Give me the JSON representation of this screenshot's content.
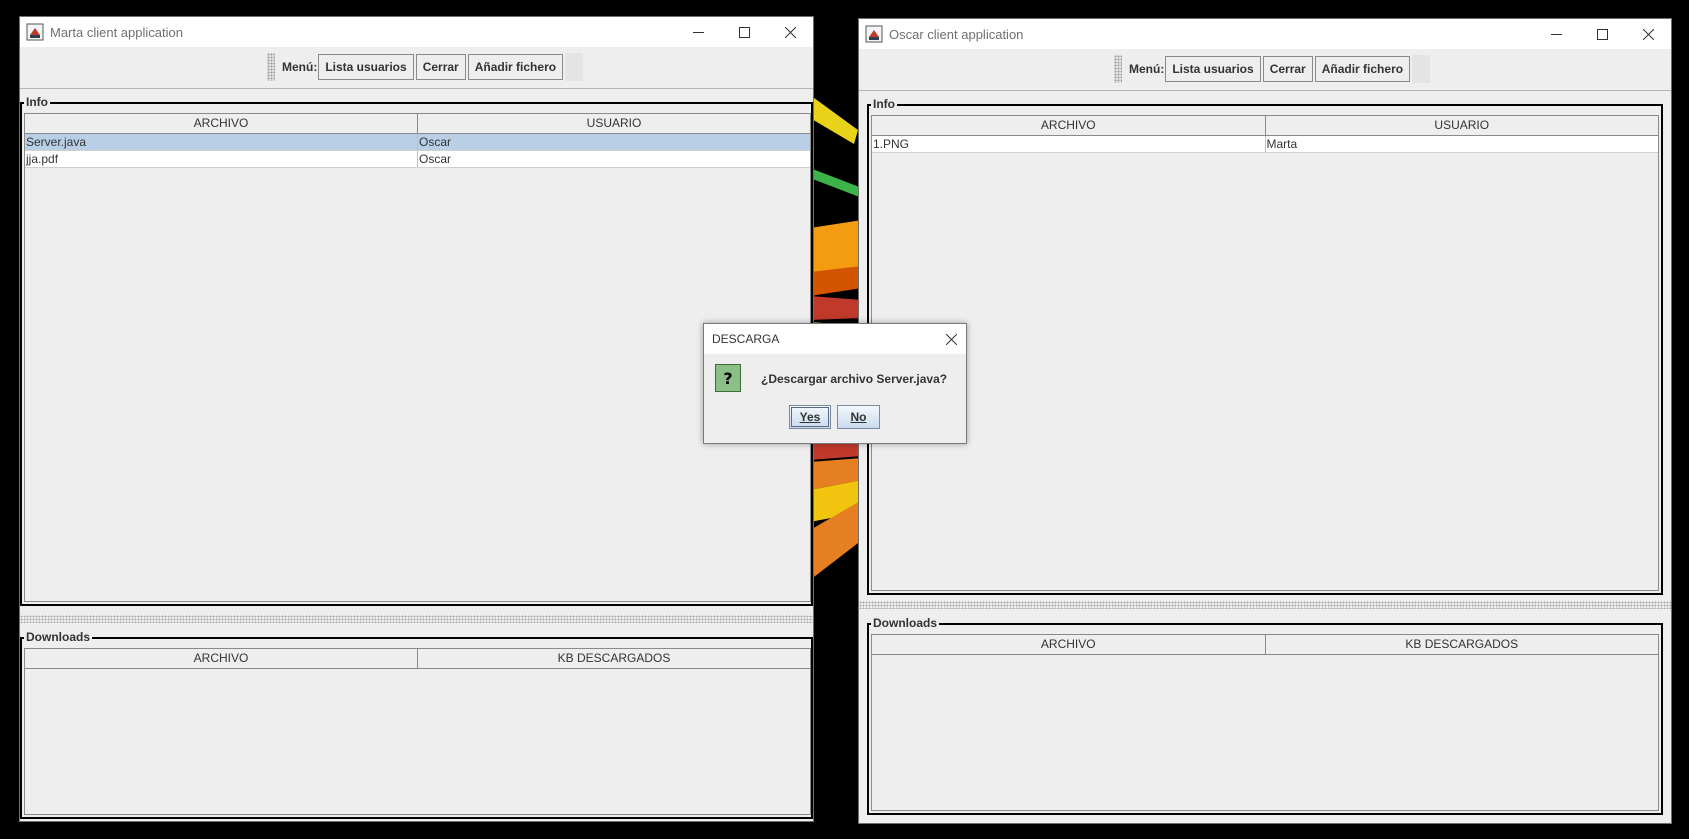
{
  "colors": {
    "desktop": "#000000",
    "window_bg": "#eeeeee",
    "titlebar_bg": "#ffffff",
    "selection": "#b8cfe5",
    "question_icon": "#8cbf87",
    "button_gradient_top": "#f4f8fc",
    "button_gradient_bottom": "#c9dbee"
  },
  "windows": {
    "left": {
      "title": "Marta client application",
      "icons": {
        "app": "java-app-icon",
        "minimize": "minimize-icon",
        "maximize": "maximize-icon",
        "close": "close-icon"
      },
      "toolbar": {
        "menu_label": "Menú:",
        "buttons": [
          "Lista usuarios",
          "Cerrar",
          "Añadir fichero"
        ]
      },
      "info": {
        "title": "Info",
        "columns": [
          "ARCHIVO",
          "USUARIO"
        ],
        "rows": [
          {
            "archivo": "Server.java",
            "usuario": "Oscar",
            "selected": true
          },
          {
            "archivo": "jja.pdf",
            "usuario": "Oscar",
            "selected": false
          }
        ]
      },
      "downloads": {
        "title": "Downloads",
        "columns": [
          "ARCHIVO",
          "KB DESCARGADOS"
        ],
        "rows": []
      }
    },
    "right": {
      "title": "Oscar client application",
      "icons": {
        "app": "java-app-icon",
        "minimize": "minimize-icon",
        "maximize": "maximize-icon",
        "close": "close-icon"
      },
      "toolbar": {
        "menu_label": "Menú:",
        "buttons": [
          "Lista usuarios",
          "Cerrar",
          "Añadir fichero"
        ]
      },
      "info": {
        "title": "Info",
        "columns": [
          "ARCHIVO",
          "USUARIO"
        ],
        "rows": [
          {
            "archivo": "1.PNG",
            "usuario": "Marta",
            "selected": false
          }
        ]
      },
      "downloads": {
        "title": "Downloads",
        "columns": [
          "ARCHIVO",
          "KB DESCARGADOS"
        ],
        "rows": []
      }
    }
  },
  "dialog": {
    "title": "DESCARGA",
    "icon": "question-icon",
    "icon_glyph": "?",
    "message": "¿Descargar archivo Server.java?",
    "yes_label": "Yes",
    "no_label": "No"
  }
}
